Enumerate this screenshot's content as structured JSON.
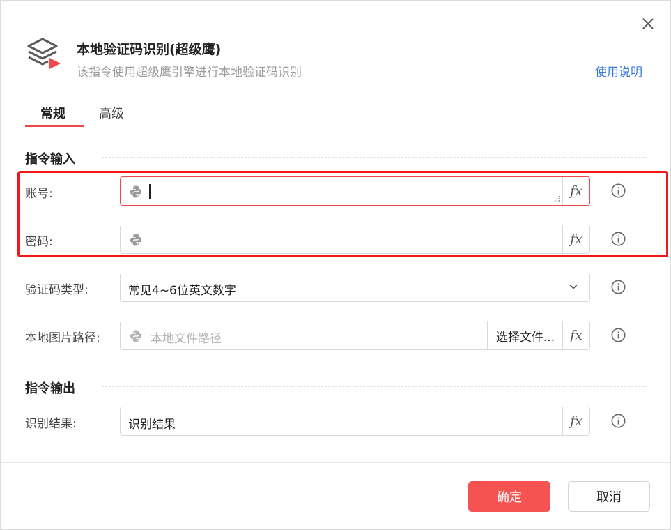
{
  "header": {
    "title": "本地验证码识别(超级鹰)",
    "subtitle": "该指令使用超级鹰引擎进行本地验证码识别",
    "help_link": "使用说明"
  },
  "tabs": [
    {
      "label": "常规",
      "active": true
    },
    {
      "label": "高级",
      "active": false
    }
  ],
  "sections": {
    "input_title": "指令输入",
    "output_title": "指令输出"
  },
  "fields": {
    "account": {
      "label": "账号:",
      "value": ""
    },
    "password": {
      "label": "密码:",
      "value": ""
    },
    "captcha_type": {
      "label": "验证码类型:",
      "value": "常见4~6位英文数字"
    },
    "image_path": {
      "label": "本地图片路径:",
      "placeholder": "本地文件路径",
      "button": "选择文件..."
    },
    "result": {
      "label": "识别结果:",
      "value": "识别结果"
    }
  },
  "fx_label": "fx",
  "buttons": {
    "confirm": "确定",
    "cancel": "取消"
  },
  "icons": {
    "app": "layers-play-icon",
    "python": "python-icon",
    "info": "info-circle-icon",
    "close": "close-icon",
    "dropdown": "chevron-down-icon"
  },
  "colors": {
    "accent": "#f04848",
    "primary_button": "#f55252",
    "link": "#3b7bd8",
    "highlight_box": "#f21818"
  }
}
